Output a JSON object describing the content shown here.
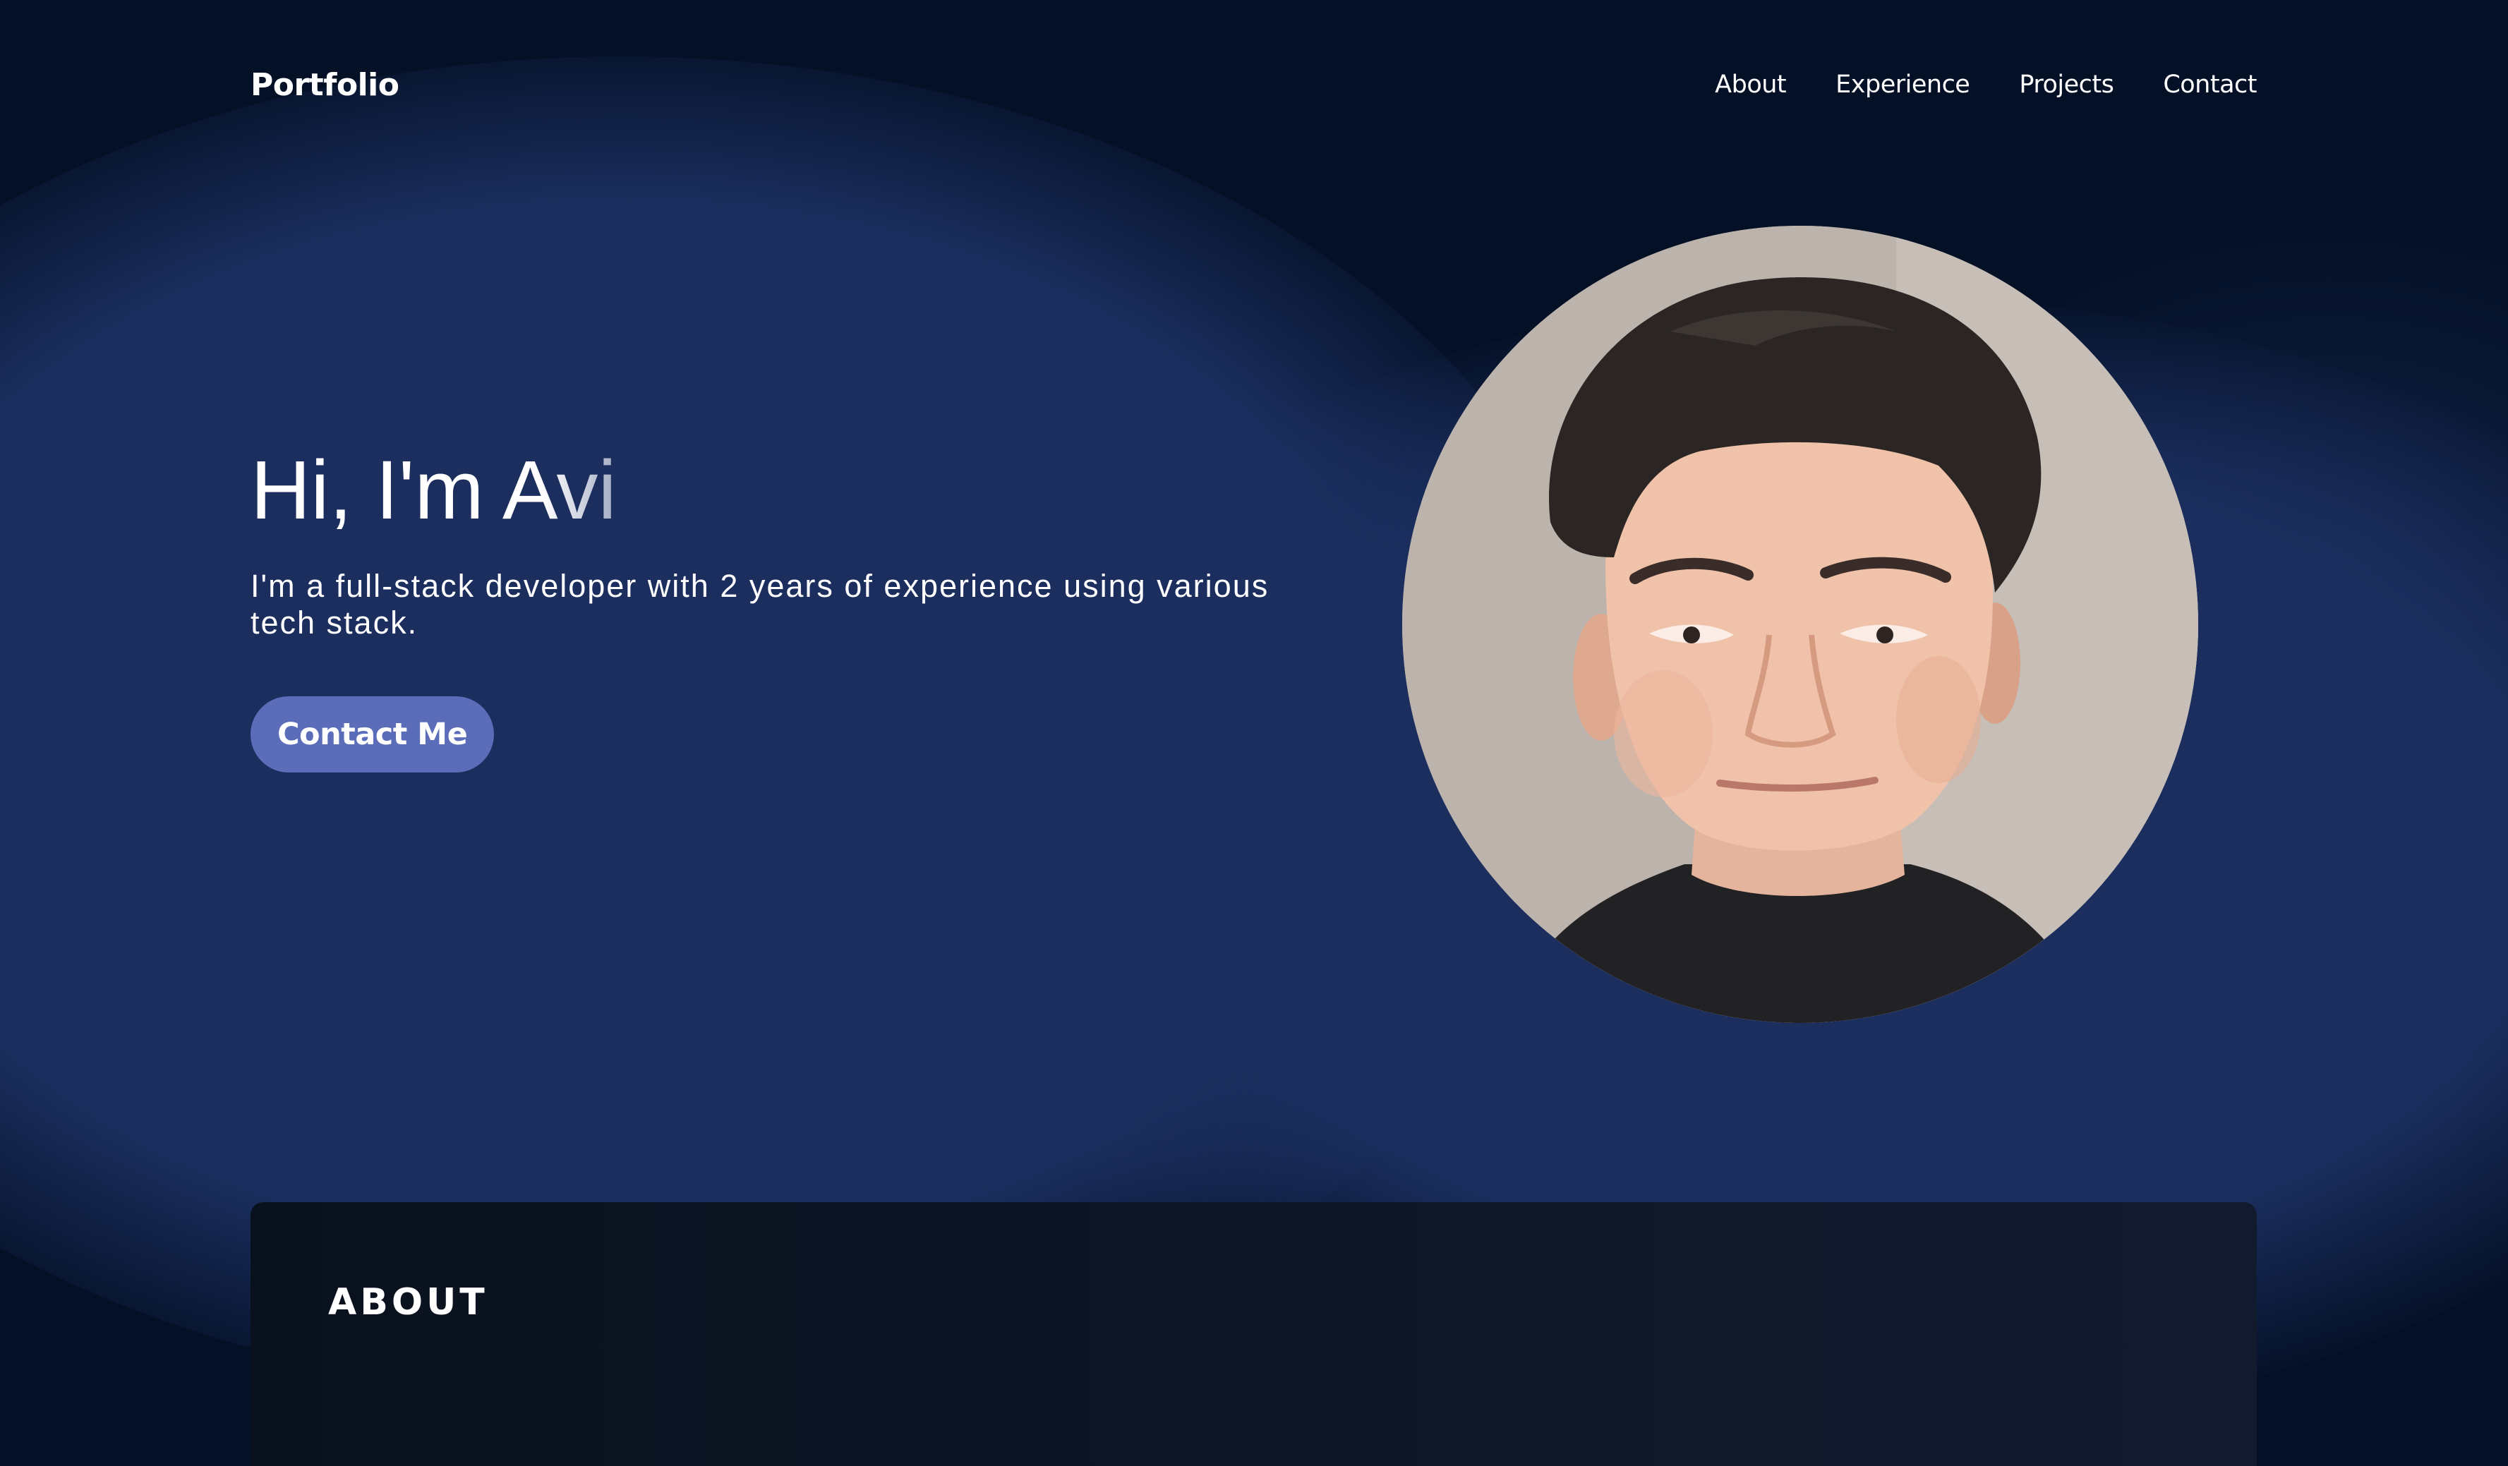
{
  "nav": {
    "brand": "Portfolio",
    "links": [
      "About",
      "Experience",
      "Projects",
      "Contact"
    ]
  },
  "hero": {
    "title_prefix": "Hi, I'm ",
    "title_name": "Avi",
    "description": "I'm a full-stack developer with 2 years of experience using various tech stack.",
    "button_label": "Contact Me"
  },
  "about": {
    "title": "ABOUT"
  },
  "colors": {
    "background": "#1b2e5e",
    "background_dark": "#041026",
    "button": "#5b6cb8",
    "card": "#0d1525",
    "text": "#ffffff"
  },
  "icons": {
    "avatar": "profile-photo"
  }
}
